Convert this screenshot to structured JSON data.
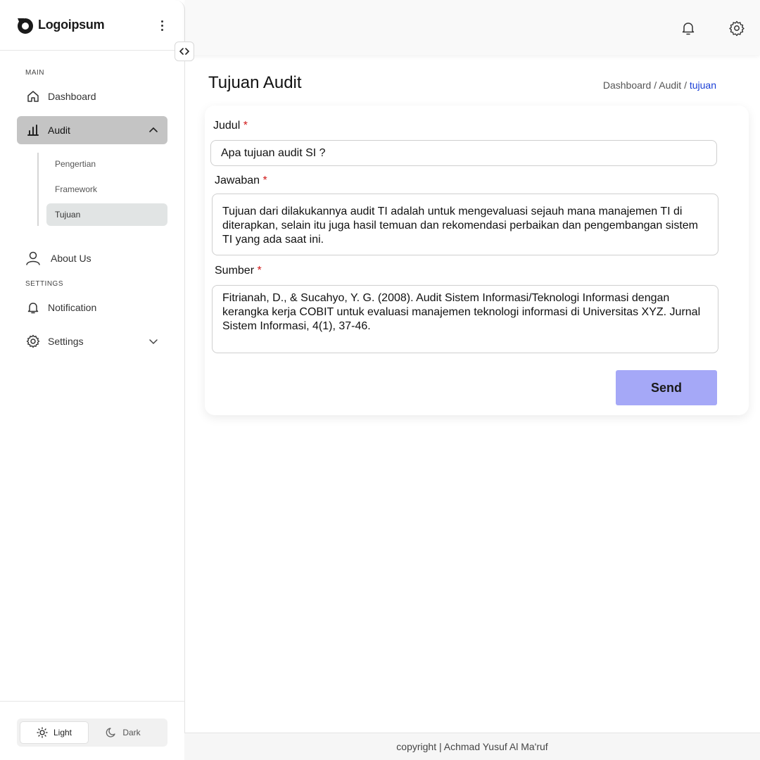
{
  "brand": {
    "name": "Logoipsum"
  },
  "sidebar": {
    "sections": {
      "main": "MAIN",
      "settings": "SETTINGS"
    },
    "items": {
      "dashboard": "Dashboard",
      "audit": "Audit",
      "about": "About Us",
      "notification": "Notification",
      "settings": "Settings"
    },
    "sub_items": [
      "Pengertian",
      "Framework",
      "Tujuan"
    ],
    "active_sub": "Tujuan",
    "theme": {
      "light": "Light",
      "dark": "Dark",
      "selected": "Light"
    }
  },
  "header": {
    "icons": [
      "bell-icon",
      "gear-icon"
    ]
  },
  "page": {
    "title": "Tujuan Audit",
    "breadcrumb": {
      "dashboard": "Dashboard",
      "audit": "Audit",
      "current": "tujuan",
      "sep": "/"
    }
  },
  "form": {
    "judul": {
      "label": "Judul",
      "required": "*",
      "value": "Apa tujuan audit SI ?"
    },
    "jawaban": {
      "label": "Jawaban",
      "required": "*",
      "value": "Tujuan dari dilakukannya audit TI adalah untuk mengevaluasi sejauh mana manajemen TI di diterapkan, selain itu juga hasil temuan dan rekomendasi perbaikan dan pengembangan sistem TI yang ada saat ini."
    },
    "sumber": {
      "label": "Sumber",
      "required": "*",
      "value": "Fitrianah, D., & Sucahyo, Y. G. (2008). Audit Sistem Informasi/Teknologi Informasi dengan kerangka kerja COBIT untuk evaluasi manajemen teknologi informasi di Universitas XYZ. Jurnal Sistem Informasi, 4(1), 37-46."
    },
    "submit": "Send"
  },
  "footer": {
    "text": "copyright | Achmad Yusuf Al Ma'ruf"
  },
  "colors": {
    "accent": "#a5a8f7",
    "link": "#1a3fd6",
    "required": "#d01818",
    "active_nav": "#c4c4c4"
  }
}
